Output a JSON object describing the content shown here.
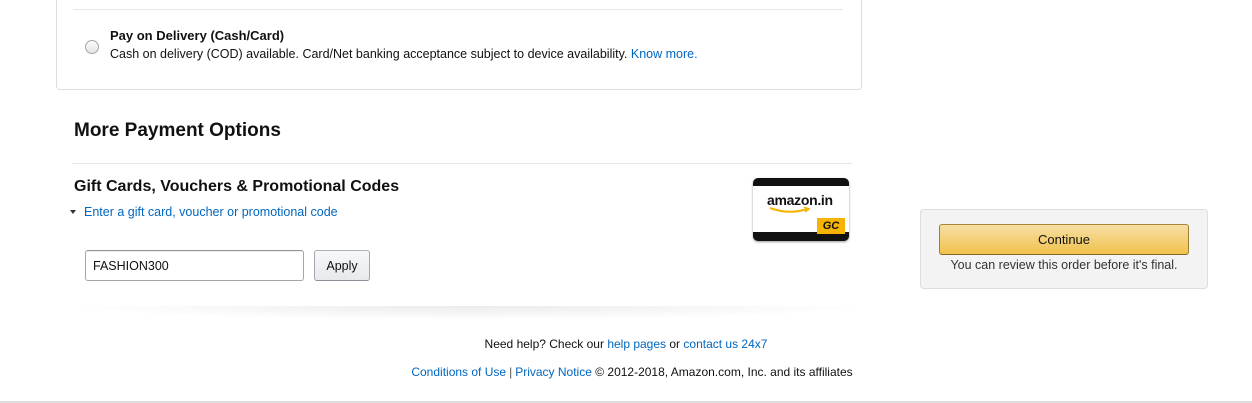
{
  "payment_option": {
    "title": "Pay on Delivery (Cash/Card)",
    "description": "Cash on delivery (COD) available. Card/Net banking acceptance subject to device availability.",
    "know_more_link": "Know more."
  },
  "more_payment": {
    "title": "More Payment Options",
    "gift_section_title": "Gift Cards, Vouchers & Promotional Codes",
    "toggle_link": "Enter a gift card, voucher or promotional code",
    "code_value": "FASHION300",
    "apply_label": "Apply",
    "gift_card": {
      "logo_text": "amazon.in",
      "badge": "GC",
      "badge_color": "#f7b301"
    }
  },
  "sidebar": {
    "continue_label": "Continue",
    "note": "You can review this order before it's final."
  },
  "footer": {
    "help_prefix": "Need help? Check our",
    "help_pages_link": "help pages",
    "or_text": "or",
    "contact_link": "contact us 24x7",
    "conditions_link": "Conditions of Use",
    "separator": "|",
    "privacy_link": "Privacy Notice",
    "copyright": "© 2012-2018, Amazon.com, Inc. and its affiliates"
  },
  "colors": {
    "link": "#0066c0",
    "continue_button": "#f0c14b"
  },
  "icons": {
    "radio": "radio-button-unselected-icon",
    "caret": "caret-down-icon",
    "smile": "amazon-smile-icon"
  }
}
